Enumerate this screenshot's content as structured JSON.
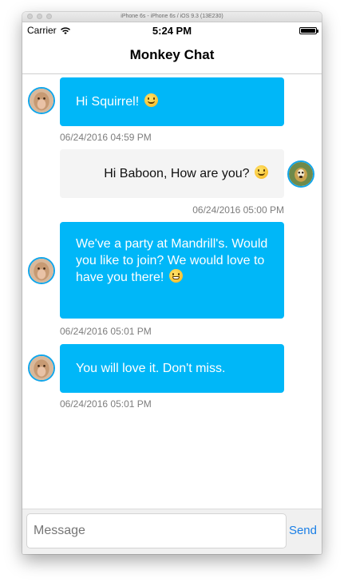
{
  "window": {
    "title": "iPhone 6s - iPhone 6s / iOS 9.3 (13E230)"
  },
  "status_bar": {
    "carrier": "Carrier",
    "time": "5:24 PM"
  },
  "nav": {
    "title": "Monkey Chat"
  },
  "messages": [
    {
      "text": "Hi Squirrel!",
      "emoji": "smile",
      "time": "06/24/2016 04:59 PM",
      "side": "incoming",
      "avatar": "baboon-avatar"
    },
    {
      "text": "Hi Baboon, How are you?",
      "emoji": "smile",
      "time": "06/24/2016 05:00 PM",
      "side": "outgoing",
      "avatar": "squirrel-monkey-avatar"
    },
    {
      "text": "We've a party at Mandrill's. Would you like to join? We would love to have you there!",
      "emoji": "grin",
      "time": "06/24/2016 05:01 PM",
      "side": "incoming",
      "avatar": "baboon-avatar"
    },
    {
      "text": "You will love it. Don't miss.",
      "emoji": "",
      "time": "06/24/2016 05:01 PM",
      "side": "incoming",
      "avatar": "baboon-avatar"
    }
  ],
  "composer": {
    "placeholder": "Message",
    "send_label": "Send"
  },
  "colors": {
    "incoming_bubble": "#00b7f8",
    "outgoing_bubble": "#f4f4f4",
    "send": "#1a7fe6",
    "avatar_border": "#12a6ea"
  }
}
